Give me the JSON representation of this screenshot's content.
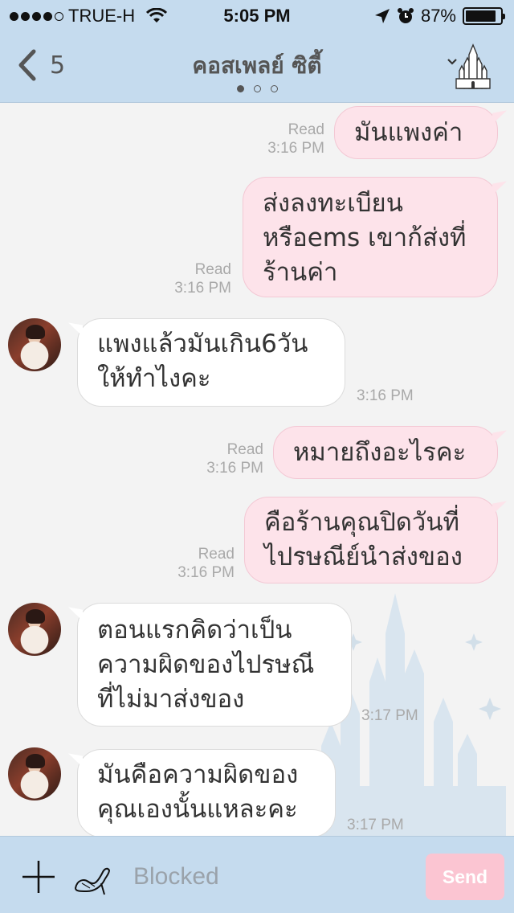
{
  "status_bar": {
    "carrier": "TRUE-H",
    "time": "5:05 PM",
    "battery": "87%",
    "battery_level": 0.87,
    "icons": [
      "signal-dots-icon",
      "wifi-icon",
      "location-arrow-icon",
      "alarm-clock-icon",
      "battery-icon"
    ]
  },
  "header": {
    "back_count": "5",
    "title": "คอสเพลย์ ซิตี้",
    "page_count": 3,
    "active_page": 1,
    "icons": [
      "back-chevron-icon",
      "menu-chevron-down-icon",
      "castle-icon"
    ]
  },
  "messages": [
    {
      "dir": "out",
      "text": "มันแพงค่า",
      "read": "Read",
      "time": "3:16 PM"
    },
    {
      "dir": "out",
      "lines": [
        "ส่งลงทะเบียน",
        "หรือems เขาก้ส่งที่",
        "ร้านค่า"
      ],
      "read": "Read",
      "time": "3:16 PM"
    },
    {
      "dir": "in",
      "lines": [
        "แพงแล้วมันเกิน6วัน",
        "ให้ทำไงคะ"
      ],
      "time": "3:16 PM"
    },
    {
      "dir": "out",
      "text": "หมายถึงอะไรคะ",
      "read": "Read",
      "time": "3:16 PM"
    },
    {
      "dir": "out",
      "lines": [
        "คือร้านคุณปิดวันที่",
        "ไปรษณีย์นำส่งของ"
      ],
      "read": "Read",
      "time": "3:16 PM"
    },
    {
      "dir": "in",
      "lines": [
        "ตอนแรกคิดว่าเป็น",
        "ความผิดของไปรษณี",
        "ที่ไม่มาส่งของ"
      ],
      "time": "3:17 PM"
    },
    {
      "dir": "in",
      "lines": [
        "มันคือความผิดของ",
        "คุณเองนั้นแหละคะ"
      ],
      "time": "3:17 PM"
    }
  ],
  "input_bar": {
    "placeholder": "Blocked",
    "send_label": "Send",
    "icons": [
      "plus-icon",
      "glass-slipper-icon"
    ]
  },
  "colors": {
    "header_bg": "#c5dbee",
    "bubble_out": "#fde3ea",
    "bubble_in": "#ffffff",
    "send_disabled": "#fbc5d2",
    "chat_bg": "#f3f3f3"
  }
}
